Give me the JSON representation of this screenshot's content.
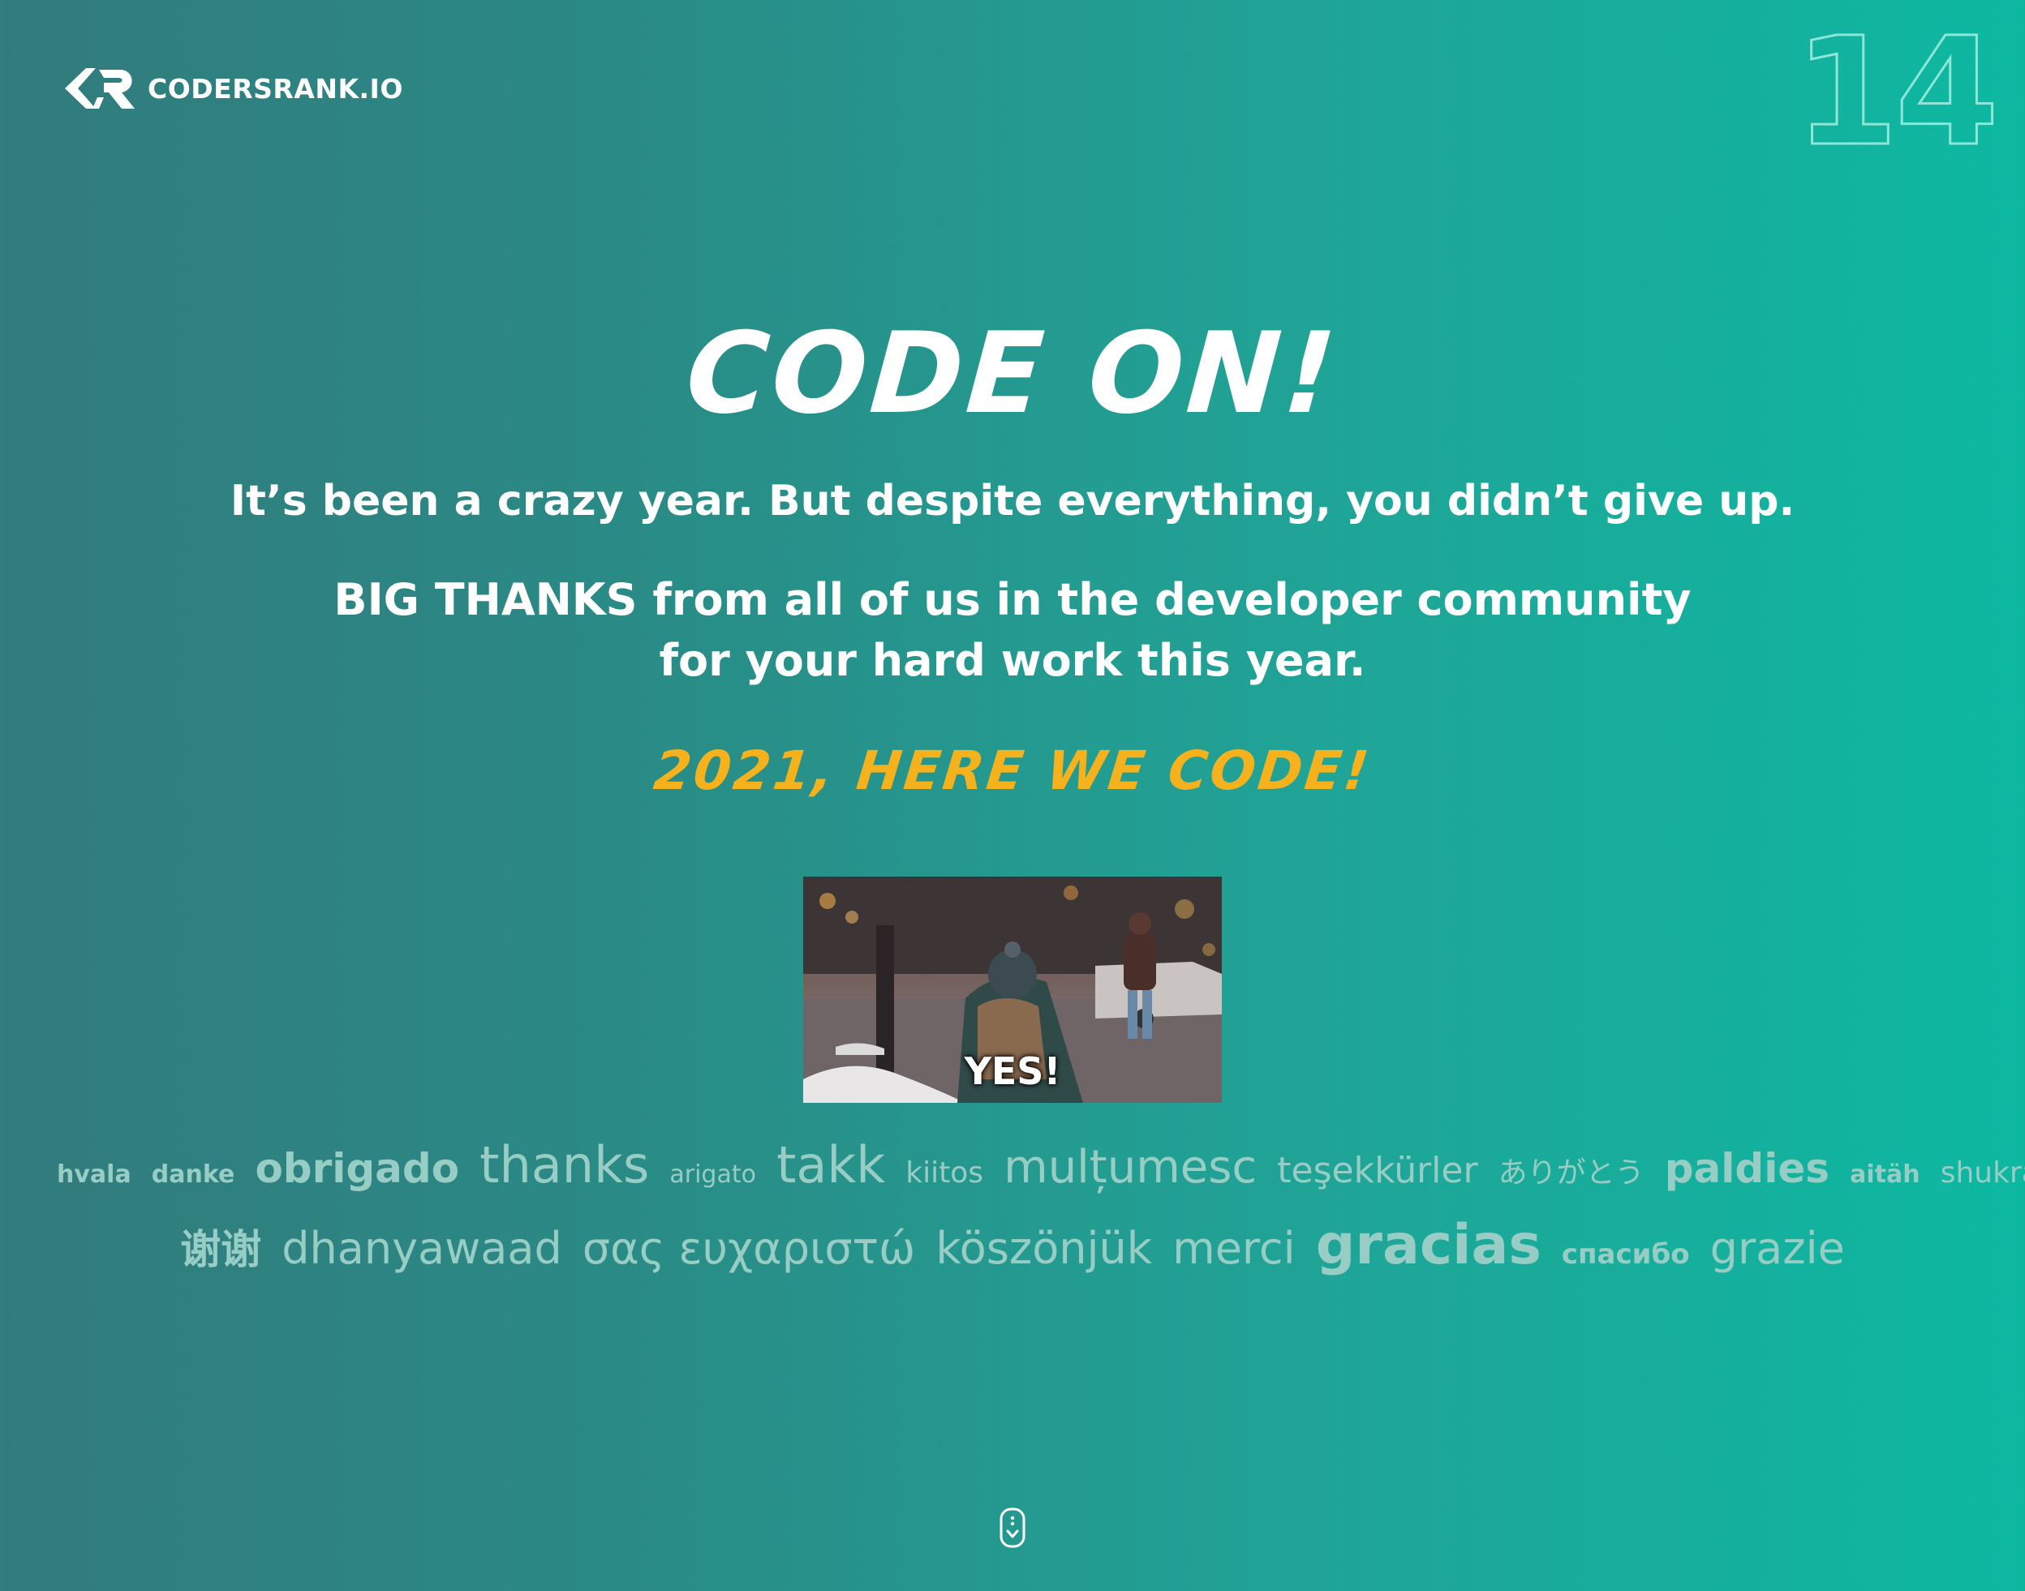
{
  "brand": {
    "name": "CODERSRANK.IO",
    "logo_icon": "codersrank-logo-icon"
  },
  "page_number": "14",
  "headline": "CODE ON!",
  "subtitle": "It’s been a crazy year. But despite everything, you didn’t give up.",
  "thanks": {
    "line1": "BIG THANKS from all of us in the developer community",
    "line2": "for your hard work this year."
  },
  "tagline": "2021, HERE WE CODE!",
  "gif": {
    "caption": "YES!"
  },
  "word_cloud": {
    "row1": [
      "hvala",
      "danke",
      "obrigado",
      "thanks",
      "arigato",
      "takk",
      "kiitos",
      "mulțumesc",
      "teşekkürler",
      "ありがとう",
      "paldies",
      "aitäh",
      "shukran"
    ],
    "row2": [
      "谢谢",
      "dhanyawaad",
      "σας ευχαριστώ",
      "köszönjük",
      "merci",
      "gracias",
      "спасибо",
      "grazie"
    ]
  },
  "scroll_hint_icon": "mouse-scroll-icon",
  "colors": {
    "gradient_left": "#327b7d",
    "gradient_right": "#0db8a1",
    "accent": "#f6b21c",
    "cloud_text": "#97cdc4"
  }
}
